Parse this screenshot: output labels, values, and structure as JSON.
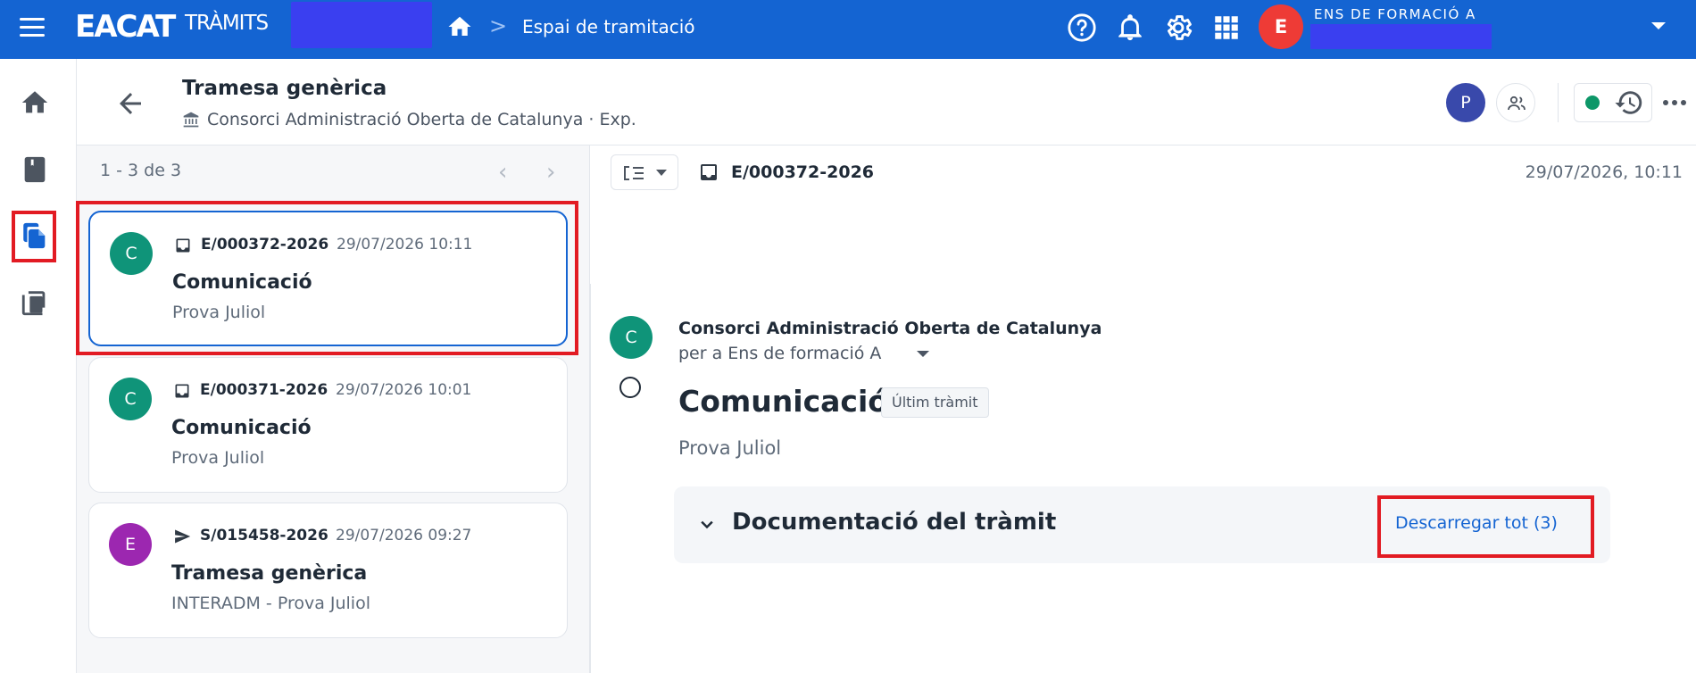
{
  "topbar": {
    "logo_main": "EACAT",
    "logo_sub": "TRÀMITS",
    "breadcrumb_sep": ">",
    "breadcrumb_current": "Espai de tramitació",
    "user_initial": "E",
    "org_name": "ENS DE FORMACIÓ A",
    "icons": [
      "help-icon",
      "bell-icon",
      "gear-icon",
      "apps-grid-icon",
      "chevron-down-icon"
    ]
  },
  "rail": {
    "items": [
      "home-icon",
      "book-icon",
      "documents-icon",
      "copy-icon"
    ],
    "active": "documents-icon"
  },
  "header": {
    "title": "Tramesa genèrica",
    "subtitle": "Consorci Administració Oberta de Catalunya · Exp.",
    "participant_initial": "P",
    "status_color": "#0d9768"
  },
  "list": {
    "pager": "1 - 3 de 3",
    "prev_arrow": "‹",
    "next_arrow": "›",
    "items": [
      {
        "initial": "C",
        "avatar_color": "#0f9479",
        "icon": "inbox-icon",
        "id": "E/000372-2026",
        "date": "29/07/2026 10:11",
        "title": "Comunicació",
        "subtitle": "Prova Juliol",
        "selected": true
      },
      {
        "initial": "C",
        "avatar_color": "#0f9479",
        "icon": "inbox-icon",
        "id": "E/000371-2026",
        "date": "29/07/2026 10:01",
        "title": "Comunicació",
        "subtitle": "Prova Juliol",
        "selected": false
      },
      {
        "initial": "E",
        "avatar_color": "#9c27b0",
        "icon": "send-icon",
        "id": "S/015458-2026",
        "date": "29/07/2026 09:27",
        "title": "Tramesa genèrica",
        "subtitle": "INTERADM - Prova Juliol",
        "selected": false
      }
    ]
  },
  "detail": {
    "doc_id": "E/000372-2026",
    "doc_date": "29/07/2026, 10:11",
    "sender_initial": "C",
    "sender": "Consorci Administració Oberta de Catalunya",
    "recipient": "per a Ens de formació A",
    "title": "Comunicació",
    "badge": "Últim tràmit",
    "subtitle": "Prova Juliol",
    "section_title": "Documentació del tràmit",
    "download_link": "Descarregar tot (3)"
  },
  "colors": {
    "brand": "#1464d2",
    "highlight": "#e21b23",
    "redaction": "#3a3ff0"
  }
}
